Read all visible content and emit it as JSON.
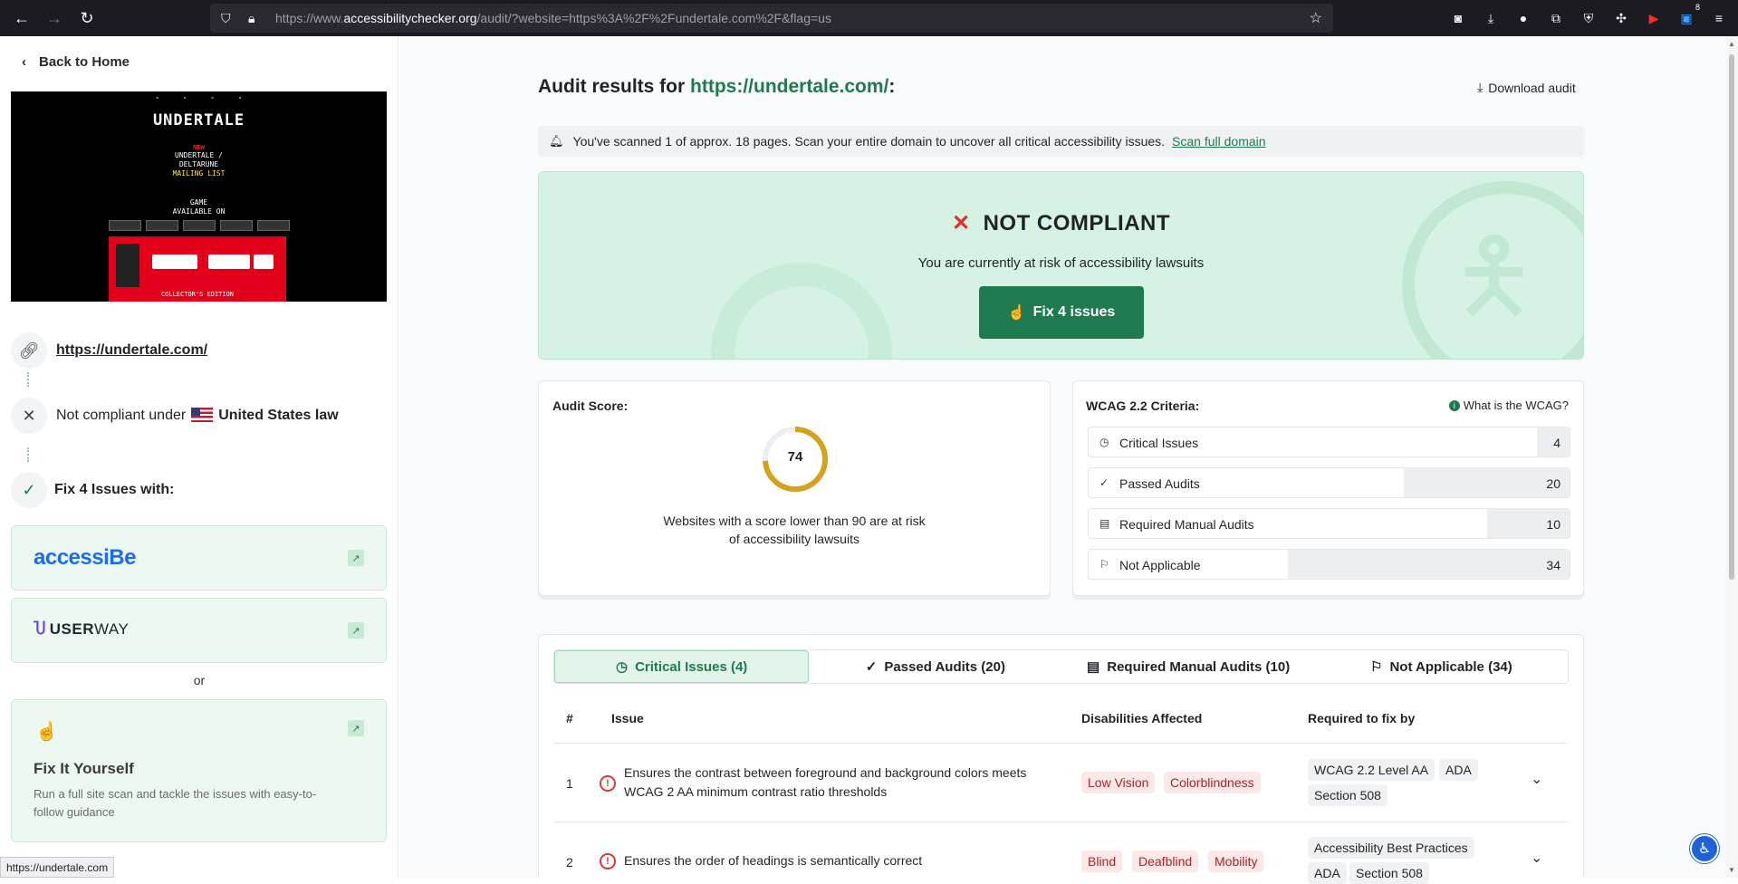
{
  "browser": {
    "url_prefix": "https://www.",
    "url_domain": "accessibilitychecker.org",
    "url_rest": "/audit/?website=https%3A%2F%2Fundertale.com%2F&flag=us",
    "badge_count": "8"
  },
  "sidebar": {
    "back_label": "Back to Home",
    "preview": {
      "title": "UNDERTALE",
      "new_label": "NEW",
      "mailing_lines": [
        "UNDERTALE /",
        "DELTARUNE"
      ],
      "mailing_highlight": "MAILING LIST",
      "game_lines": [
        "GAME",
        "AVAILABLE ON"
      ],
      "collector": "COLLECTOR'S EDITION"
    },
    "site_link": "https://undertale.com/",
    "law_prefix": "Not compliant under",
    "law_country": "United States law",
    "fix_title": "Fix 4 Issues with:",
    "vendor1": "accessiBe",
    "vendor2_brand": "USER",
    "vendor2_suffix": "WAY",
    "or_label": "or",
    "diy_title": "Fix It Yourself",
    "diy_text": "Run a full site scan and tackle the issues with easy-to-follow guidance",
    "status_url": "https://undertale.com"
  },
  "main": {
    "title_prefix": "Audit results for",
    "title_site": "https://undertale.com/",
    "title_suffix": ":",
    "download_label": "Download audit",
    "notice_text": "You've scanned 1 of approx. 18 pages. Scan your entire domain to uncover all critical accessibility issues.",
    "notice_link": "Scan full domain",
    "status_label": "NOT COMPLIANT",
    "status_sub": "You are currently at risk of accessibility lawsuits",
    "fix_button": "Fix 4 issues",
    "score": {
      "title": "Audit Score:",
      "value": "74",
      "progress": 0.74,
      "message_line1": "Websites with a score lower than 90 are at risk",
      "message_line2": "of accessibility lawsuits"
    },
    "wcag": {
      "title": "WCAG 2.2 Criteria:",
      "what_link": "What is the WCAG?",
      "rows": [
        {
          "label": "Critical Issues",
          "value": "4",
          "icon": "clock-alert-icon"
        },
        {
          "label": "Passed Audits",
          "value": "20",
          "icon": "check-icon"
        },
        {
          "label": "Required Manual Audits",
          "value": "10",
          "icon": "document-icon"
        },
        {
          "label": "Not Applicable",
          "value": "34",
          "icon": "flag-icon"
        }
      ]
    },
    "tabs": [
      {
        "label": "Critical Issues (4)",
        "icon": "clock-alert-icon"
      },
      {
        "label": "Passed Audits (20)",
        "icon": "check-icon"
      },
      {
        "label": "Required Manual Audits (10)",
        "icon": "document-icon"
      },
      {
        "label": "Not Applicable (34)",
        "icon": "flag-icon"
      }
    ],
    "table_headers": {
      "num": "#",
      "issue": "Issue",
      "disabilities": "Disabilities Affected",
      "required": "Required to fix by"
    },
    "issues": [
      {
        "num": "1",
        "text": "Ensures the contrast between foreground and background colors meets WCAG 2 AA minimum contrast ratio thresholds",
        "disabilities": [
          "Low Vision",
          "Colorblindness"
        ],
        "required": [
          "WCAG 2.2 Level AA",
          "ADA",
          "Section 508"
        ]
      },
      {
        "num": "2",
        "text": "Ensures the order of headings is semantically correct",
        "disabilities": [
          "Blind",
          "Deafblind",
          "Mobility"
        ],
        "required": [
          "Accessibility Best Practices",
          "ADA",
          "Section 508"
        ]
      }
    ]
  },
  "colors": {
    "accent": "#1f7a4d",
    "danger": "#e02d2d",
    "hero_bg": "#d6f2e4"
  }
}
